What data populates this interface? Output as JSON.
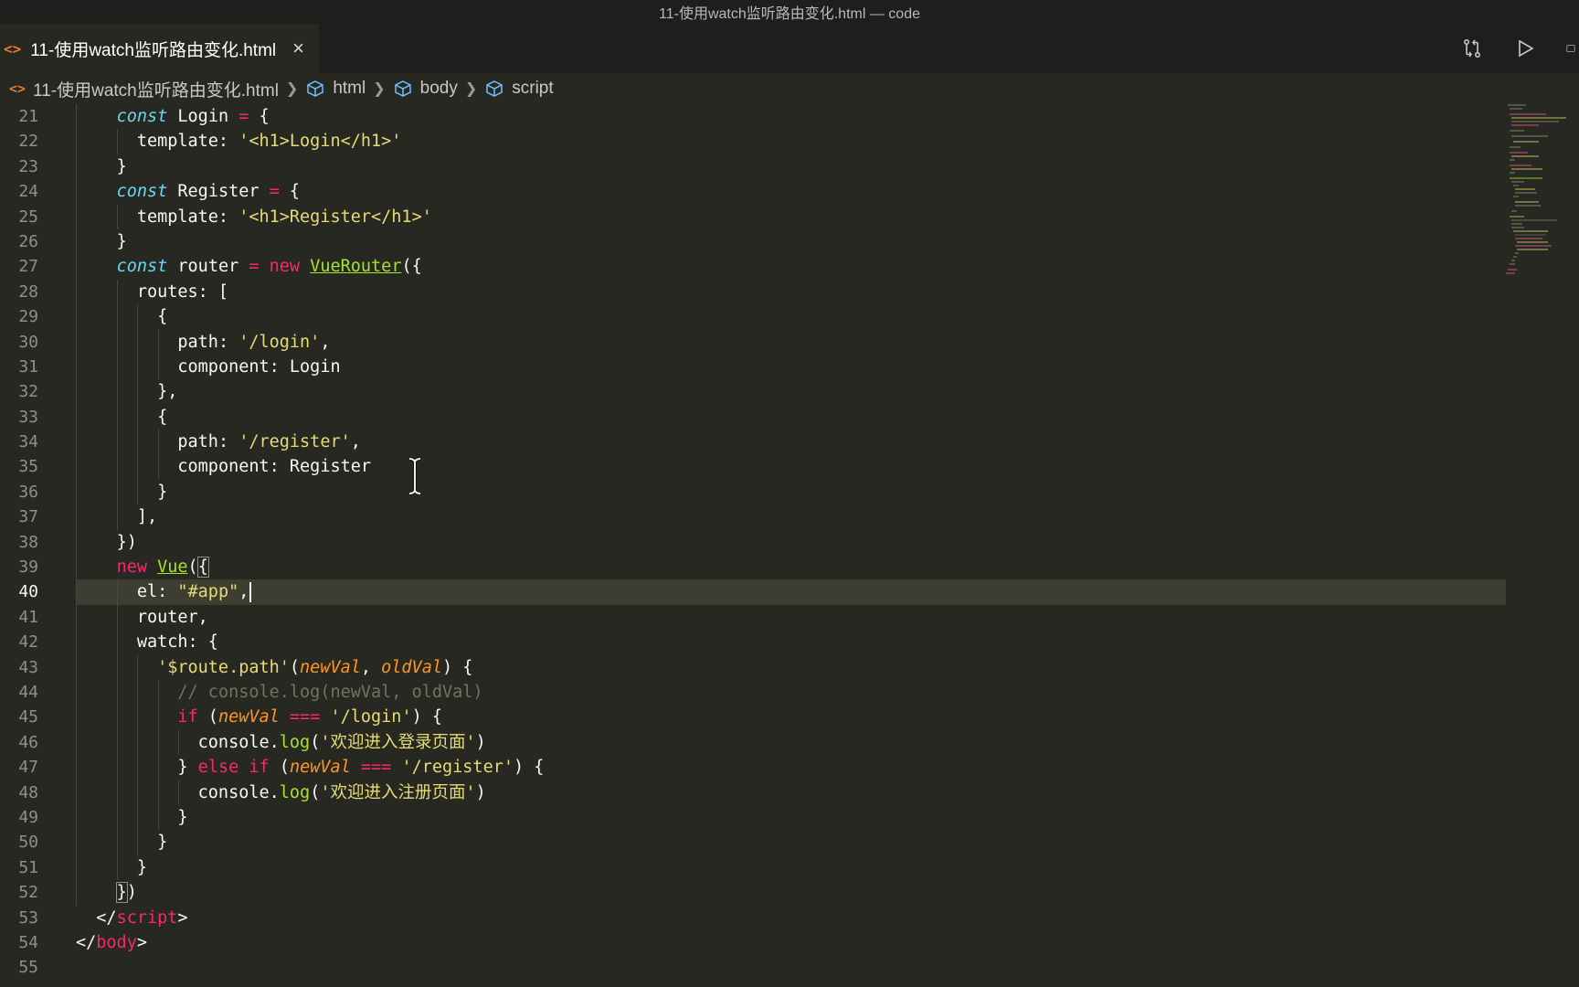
{
  "window": {
    "title": "11-使用watch监听路由变化.html — code"
  },
  "tab": {
    "label": "11-使用watch监听路由变化.html",
    "icon": "html-file-icon"
  },
  "tab_actions": [
    {
      "name": "compare-changes-icon"
    },
    {
      "name": "run-icon"
    },
    {
      "name": "split-editor-icon"
    }
  ],
  "breadcrumb": {
    "file": "11-使用watch监听路由变化.html",
    "items": [
      "html",
      "body",
      "script"
    ]
  },
  "colors": {
    "background": "#272822",
    "keyword": "#f92672",
    "storage": "#66d9ef",
    "string": "#e6db74",
    "function": "#a6e22e",
    "parameter": "#fd971f",
    "comment": "#75715e"
  },
  "editor": {
    "active_line": 40,
    "line_numbers": [
      "21",
      "22",
      "23",
      "24",
      "25",
      "26",
      "27",
      "28",
      "29",
      "30",
      "31",
      "32",
      "33",
      "34",
      "35",
      "36",
      "37",
      "38",
      "39",
      "40",
      "41",
      "42",
      "43",
      "44",
      "45",
      "46",
      "47",
      "48",
      "49",
      "50",
      "51",
      "52",
      "53",
      "54",
      "55"
    ],
    "lines": {
      "l21": {
        "kw": "const",
        "a": " Login ",
        "op": "=",
        "b": " {"
      },
      "l22": {
        "a": "template: ",
        "str": "'<h1>Login</h1>'"
      },
      "l23": {
        "a": "}"
      },
      "l24": {
        "kw": "const",
        "a": " Register ",
        "op": "=",
        "b": " {"
      },
      "l25": {
        "a": "template: ",
        "str": "'<h1>Register</h1>'"
      },
      "l26": {
        "a": "}"
      },
      "l27": {
        "kw": "const",
        "a": " router ",
        "op": "=",
        "new": "new",
        "cls": "VueRouter",
        "b": "({"
      },
      "l28": {
        "a": "routes: ["
      },
      "l29": {
        "a": "{"
      },
      "l30": {
        "a": "path: ",
        "str": "'/login'",
        "b": ","
      },
      "l31": {
        "a": "component: Login"
      },
      "l32": {
        "a": "},"
      },
      "l33": {
        "a": "{"
      },
      "l34": {
        "a": "path: ",
        "str": "'/register'",
        "b": ","
      },
      "l35": {
        "a": "component: Register"
      },
      "l36": {
        "a": "}"
      },
      "l37": {
        "a": "],"
      },
      "l38": {
        "a": "})"
      },
      "l39": {
        "new": "new",
        "cls": "Vue",
        "b": "(",
        "c": "{"
      },
      "l40": {
        "a": "el: ",
        "str": "\"#app\"",
        "b": ","
      },
      "l41": {
        "a": "router,"
      },
      "l42": {
        "a": "watch: {"
      },
      "l43": {
        "str": "'$route.path'",
        "a": "(",
        "p1": "newVal",
        "b": ", ",
        "p2": "oldVal",
        "c": ") {"
      },
      "l44": {
        "cmt": "// console.log(newVal, oldVal)"
      },
      "l45": {
        "kw": "if",
        "a": " (",
        "p1": "newVal",
        "b": " ",
        "op": "===",
        "c": " ",
        "str": "'/login'",
        "d": ") {"
      },
      "l46": {
        "a": "console.",
        "fn": "log",
        "b": "(",
        "str": "'欢迎进入登录页面'",
        "c": ")"
      },
      "l47": {
        "a": "} ",
        "kw1": "else",
        "b": " ",
        "kw2": "if",
        "c": " (",
        "p1": "newVal",
        "d": " ",
        "op": "===",
        "e": " ",
        "str": "'/register'",
        "f": ") {"
      },
      "l48": {
        "a": "console.",
        "fn": "log",
        "b": "(",
        "str": "'欢迎进入注册页面'",
        "c": ")"
      },
      "l49": {
        "a": "}"
      },
      "l50": {
        "a": "}"
      },
      "l51": {
        "a": "}"
      },
      "l52": {
        "a": "}",
        "b": ")"
      },
      "l53": {
        "a": "</",
        "tag": "script",
        "b": ">"
      },
      "l54": {
        "a": "</",
        "tag": "body",
        "b": ">"
      },
      "l55": {
        "a": ""
      }
    }
  }
}
